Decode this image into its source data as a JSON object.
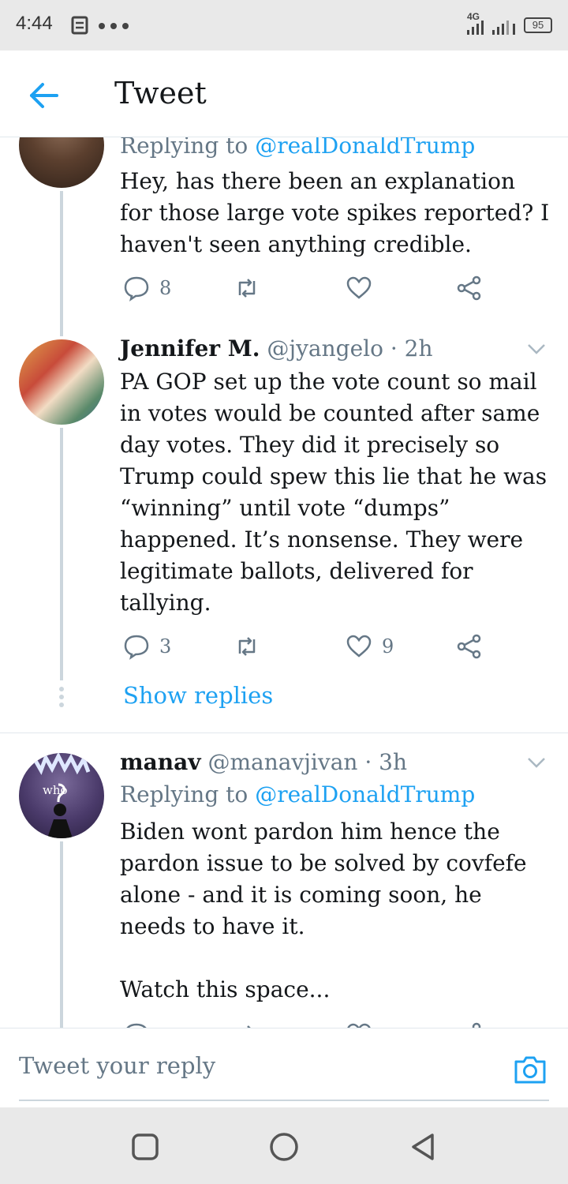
{
  "status_bar": {
    "time": "4:44",
    "network": "4G",
    "battery": "95"
  },
  "header": {
    "title": "Tweet"
  },
  "tweets": [
    {
      "reply_prefix": "Replying to",
      "reply_mention": "@realDonaldTrump",
      "text": "Hey, has there been an explanation for those large vote spikes reported? I haven't seen anything credible.",
      "actions": {
        "replies": "8",
        "retweets": "",
        "likes": ""
      }
    },
    {
      "name": "Jennifer M.",
      "handle": "@jyangelo · 2h",
      "text": "PA GOP set up the vote count so mail in votes would be counted after same day votes. They did it precisely so Trump could spew this lie that he was “winning” until vote “dumps” happened. It’s nonsense. They were legitimate ballots, delivered for tallying.",
      "actions": {
        "replies": "3",
        "retweets": "",
        "likes": "9"
      },
      "show_replies": "Show replies"
    },
    {
      "name": "manav",
      "handle": "@manavjivan · 3h",
      "reply_prefix": "Replying to",
      "reply_mention": "@realDonaldTrump",
      "text_line1": "Biden wont pardon him hence the pardon issue to be solved by covfefe alone - and it is coming soon, he needs to have it.",
      "text_line2": "Watch this space...",
      "avatar_text": "who"
    }
  ],
  "reply_bar": {
    "placeholder": "Tweet your reply"
  },
  "colors": {
    "accent": "#1da1f2",
    "secondary": "#657786",
    "line": "#ccd6dd"
  }
}
